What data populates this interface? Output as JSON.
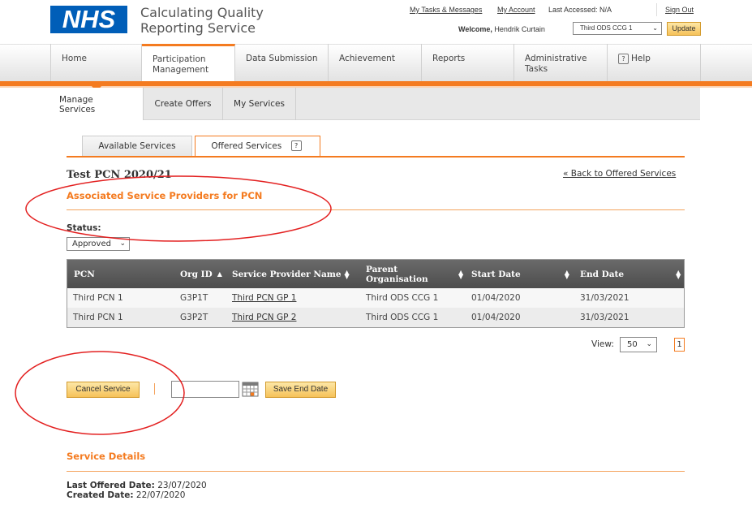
{
  "header": {
    "logo_text": "NHS",
    "app_title_line1": "Calculating Quality",
    "app_title_line2": "Reporting Service",
    "links": {
      "tasks": "My Tasks & Messages",
      "account": "My Account",
      "sign_out": "Sign Out"
    },
    "last_accessed": "Last Accessed: N/A",
    "welcome_label": "Welcome,",
    "user_name": "Hendrik Curtain",
    "org_selected": "Third ODS CCG 1",
    "update_label": "Update"
  },
  "main_nav": {
    "tabs": [
      {
        "label": "Home"
      },
      {
        "label": "Participation Management"
      },
      {
        "label": "Data Submission"
      },
      {
        "label": "Achievement"
      },
      {
        "label": "Reports"
      },
      {
        "label": "Administrative Tasks"
      },
      {
        "label": "Help"
      }
    ],
    "help_icon": "?"
  },
  "sub_nav": {
    "tabs": [
      {
        "label": "Manage Services"
      },
      {
        "label": "Create Offers"
      },
      {
        "label": "My Services"
      }
    ]
  },
  "inner_tabs": {
    "available": "Available Services",
    "offered": "Offered Services",
    "help_icon": "?"
  },
  "page": {
    "title": "Test PCN 2020/21",
    "back_link": "« Back to Offered Services",
    "section_heading": "Associated Service Providers for PCN",
    "status_label": "Status:",
    "status_value": "Approved"
  },
  "table": {
    "columns": [
      "PCN",
      "Org ID",
      "Service Provider Name",
      "Parent Organisation",
      "Start Date",
      "End Date"
    ],
    "rows": [
      [
        "Third PCN 1",
        "G3P1T",
        "Third PCN GP 1",
        "Third ODS CCG 1",
        "01/04/2020",
        "31/03/2021"
      ],
      [
        "Third PCN 1",
        "G3P2T",
        "Third PCN GP 2",
        "Third ODS CCG 1",
        "01/04/2020",
        "31/03/2021"
      ]
    ]
  },
  "pager": {
    "view_label": "View:",
    "view_value": "50",
    "page": "1"
  },
  "actions": {
    "cancel_label": "Cancel Service",
    "end_date_value": "",
    "save_end_label": "Save End Date"
  },
  "details": {
    "heading": "Service Details",
    "last_offered_label": "Last Offered Date:",
    "last_offered_value": "23/07/2020",
    "created_label": "Created Date:",
    "created_value": "22/07/2020"
  },
  "colors": {
    "nhs_blue": "#005eb8",
    "accent_orange": "#f47b20",
    "annotation_red": "#e32020"
  },
  "icons": {
    "sort": "sort-updown-icon",
    "sort_asc": "sort-asc-icon",
    "calendar": "calendar-icon",
    "chevron": "chevron-down-icon"
  }
}
